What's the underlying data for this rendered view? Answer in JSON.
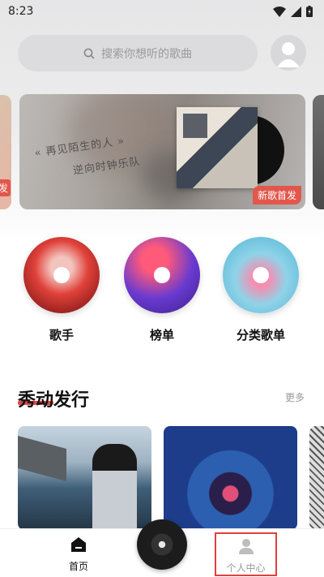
{
  "status_bar": {
    "time": "8:23"
  },
  "search": {
    "placeholder": "搜索你想听的歌曲"
  },
  "banner": {
    "handwriting_line1": "« 再见陌生的人 »",
    "handwriting_line2": "逆向时钟乐队",
    "tag": "新歌首发",
    "left_peek_tag": "发"
  },
  "categories": [
    {
      "label": "歌手"
    },
    {
      "label": "榜单"
    },
    {
      "label": "分类歌单"
    }
  ],
  "section": {
    "title": "秀动发行",
    "more": "更多"
  },
  "tabs": {
    "home": "首页",
    "profile": "个人中心"
  },
  "colors": {
    "accent": "#e2574c",
    "highlight_border": "#e0403f"
  }
}
